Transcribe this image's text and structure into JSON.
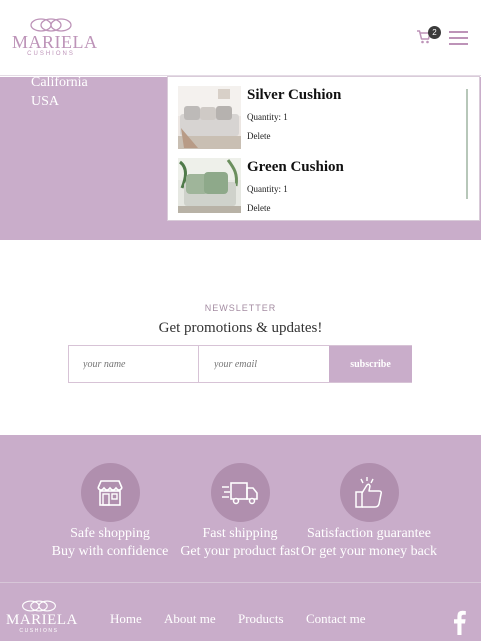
{
  "brand": {
    "name": "MARIELA",
    "tagline": "CUSHIONS"
  },
  "header": {
    "cart_count": "2"
  },
  "address": {
    "line1": "California",
    "line2": "USA"
  },
  "cart": {
    "items": [
      {
        "name": "Silver Cushion",
        "quantity": "Quantity: 1",
        "delete": "Delete"
      },
      {
        "name": "Green Cushion",
        "quantity": "Quantity: 1",
        "delete": "Delete"
      }
    ]
  },
  "newsletter": {
    "label": "NEWSLETTER",
    "title": "Get promotions & updates!",
    "name_placeholder": "your name",
    "email_placeholder": "your email",
    "button": "subscribe"
  },
  "features": [
    {
      "title": "Safe shopping",
      "subtitle": "Buy with confidence",
      "icon": "store-icon"
    },
    {
      "title": "Fast shipping",
      "subtitle": "Get your product fast",
      "icon": "truck-icon"
    },
    {
      "title": "Satisfaction guarantee",
      "subtitle": "Or get your money back",
      "icon": "thumbs-up-icon"
    }
  ],
  "footer": {
    "nav": [
      "Home",
      "About me",
      "Products",
      "Contact me"
    ],
    "social_icon": "facebook-icon"
  },
  "colors": {
    "accent": "#c9adca",
    "logo": "#bd93b8",
    "circle": "#b08fae"
  }
}
